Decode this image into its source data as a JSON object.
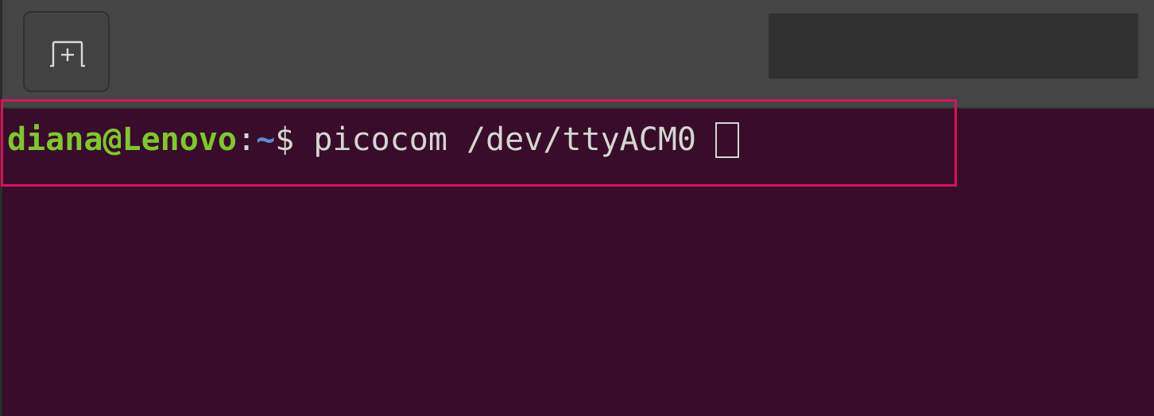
{
  "prompt": {
    "user_host": "diana@Lenovo",
    "colon": ":",
    "path": "~",
    "dollar": "$",
    "command": " picocom /dev/ttyACM0"
  },
  "colors": {
    "terminal_bg": "#380c2a",
    "headerbar_bg": "#454545",
    "prompt_user": "#7fc72f",
    "prompt_path": "#5c8dd6",
    "text": "#d3d7cf",
    "highlight": "#d4145a"
  },
  "icons": {
    "new_tab": "new-tab-icon"
  }
}
